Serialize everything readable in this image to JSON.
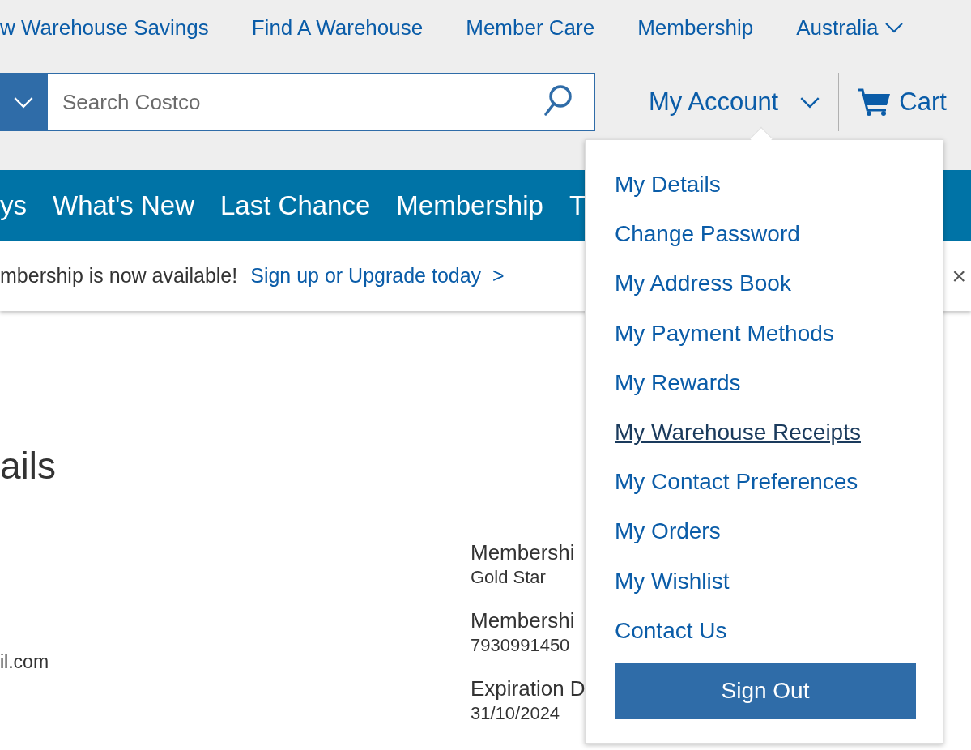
{
  "top_links": [
    "w Warehouse Savings",
    "Find A Warehouse",
    "Member Care",
    "Membership",
    "Australia"
  ],
  "search": {
    "placeholder": "Search Costco"
  },
  "account": {
    "label": "My Account",
    "expanded": true
  },
  "cart": {
    "label": "Cart"
  },
  "nav": [
    "ys",
    "What's New",
    "Last Chance",
    "Membership",
    "T"
  ],
  "banner": {
    "text": "mbership is now available!",
    "link": "Sign up or Upgrade today  >",
    "close": "×"
  },
  "content": {
    "heading": "ails",
    "email": "il.com",
    "fields": [
      {
        "label": "Membershi",
        "value": "Gold Star"
      },
      {
        "label": "Membershi",
        "value": "7930991450"
      },
      {
        "label": "Expiration D",
        "value": "31/10/2024"
      }
    ]
  },
  "menu": {
    "items": [
      {
        "label": "My Details",
        "hovered": false
      },
      {
        "label": "Change Password",
        "hovered": false
      },
      {
        "label": "My Address Book",
        "hovered": false
      },
      {
        "label": "My Payment Methods",
        "hovered": false
      },
      {
        "label": "My Rewards",
        "hovered": false
      },
      {
        "label": "My Warehouse Receipts",
        "hovered": true
      },
      {
        "label": "My Contact Preferences",
        "hovered": false
      },
      {
        "label": "My Orders",
        "hovered": false
      },
      {
        "label": "My Wishlist",
        "hovered": false
      },
      {
        "label": "Contact Us",
        "hovered": false
      }
    ],
    "sign_out": "Sign Out"
  }
}
